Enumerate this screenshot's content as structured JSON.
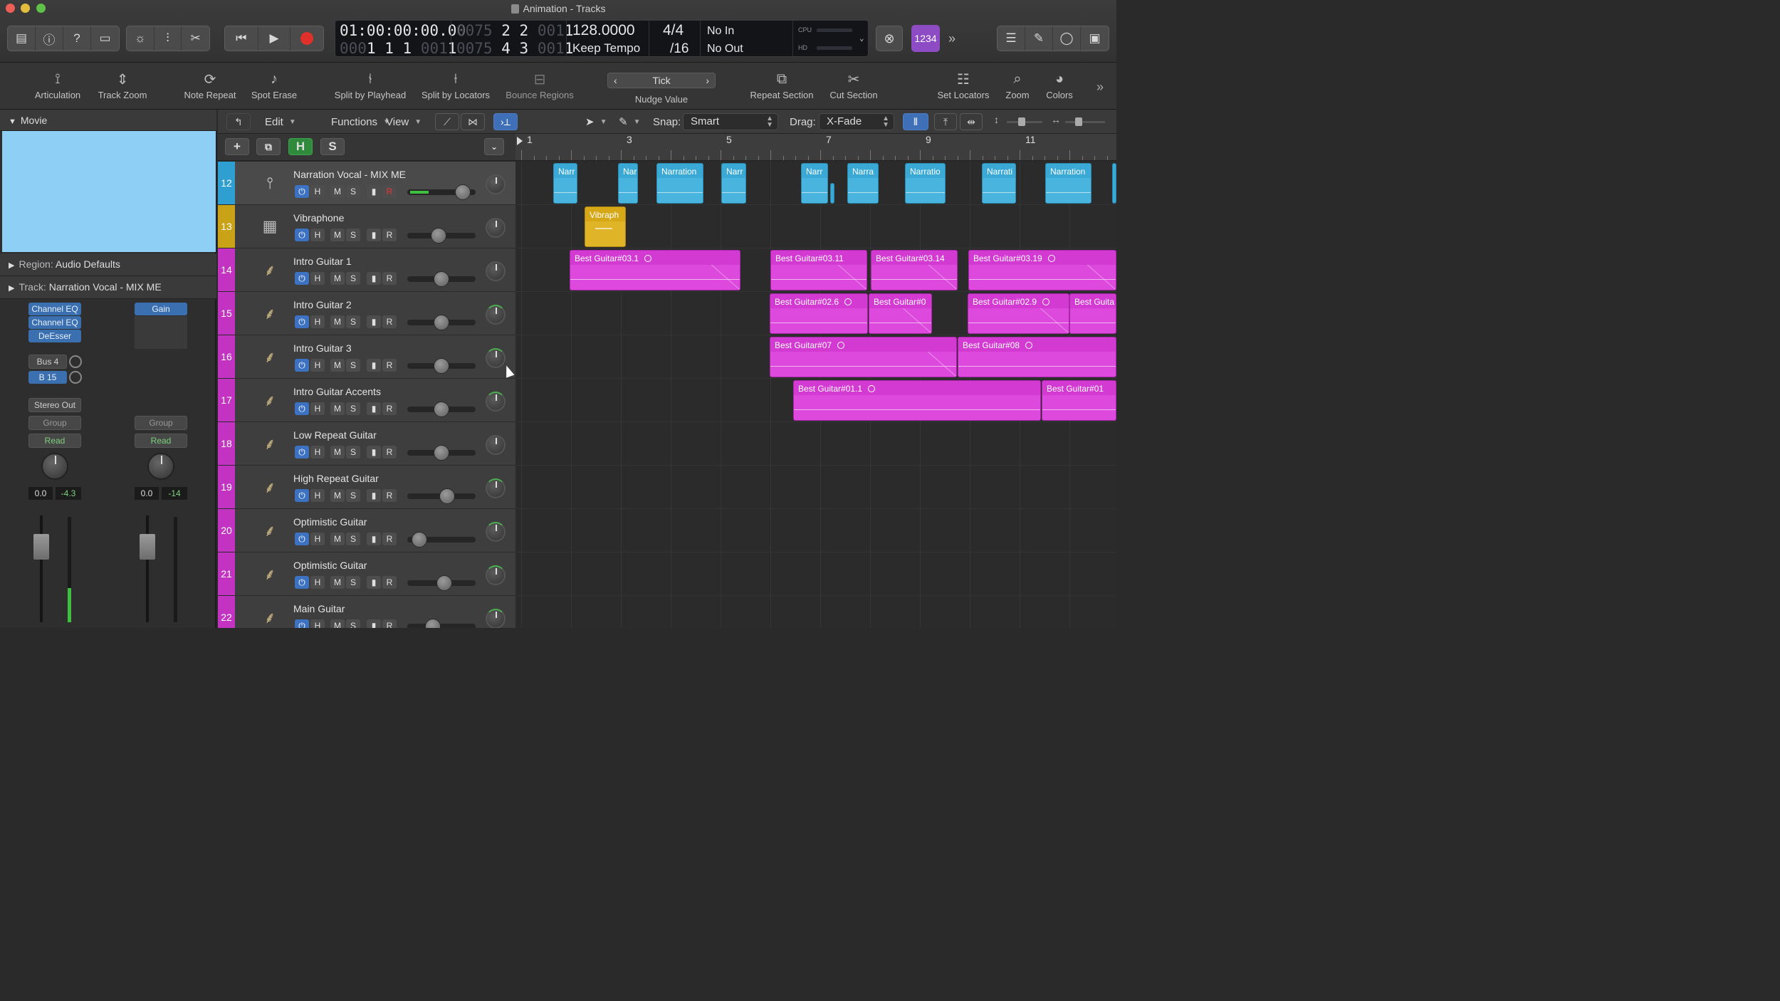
{
  "window": {
    "title": "Animation - Tracks"
  },
  "lcd": {
    "smpte": "01:00:00:00.00",
    "smpte_sub_dim": "000",
    "smpte_sub": "1  1  1",
    "smpte_sub_tail_dim": "001",
    "smpte_sub_tail": "1",
    "bars_top_dim": "0075",
    "bars_top": "2  2",
    "bars_top_tail_dim": "001",
    "bars_top_tail": "1",
    "bars_bot_dim": "0075",
    "bars_bot": "4  3",
    "bars_bot_tail_dim": "001",
    "bars_bot_tail": "1",
    "tempo": "128.0000",
    "tempo_mode": "Keep Tempo",
    "signature_top": "4/4",
    "signature_bottom": "/16",
    "in_label": "No In",
    "out_label": "No Out",
    "cpu_label": "CPU",
    "hd_label": "HD"
  },
  "badge": "1234",
  "toolbar": {
    "articulation": "Articulation",
    "track_zoom": "Track Zoom",
    "note_repeat": "Note Repeat",
    "spot_erase": "Spot Erase",
    "split_by_playhead": "Split by Playhead",
    "split_by_locators": "Split by Locators",
    "bounce_regions": "Bounce Regions",
    "nudge_value_label": "Nudge Value",
    "nudge_value": "Tick",
    "repeat_section": "Repeat Section",
    "cut_section": "Cut Section",
    "set_locators": "Set Locators",
    "zoom": "Zoom",
    "colors": "Colors"
  },
  "inspector": {
    "movie_label": "Movie",
    "region_label": "Region:",
    "region_value": "Audio Defaults",
    "track_label": "Track:",
    "track_value": "Narration Vocal - MIX ME",
    "plugins": [
      "Channel EQ",
      "Channel EQ",
      "DeEsser"
    ],
    "gain_plugin": "Gain",
    "bus_label": "Bus 4",
    "bus_value": "B 15",
    "output": "Stereo Out",
    "group_left": "Group",
    "group_right": "Group",
    "read_left": "Read",
    "read_right": "Read",
    "vol_left": "0.0",
    "peak_left": "-4.3",
    "vol_right": "0.0",
    "peak_right": "-14"
  },
  "tracks_toolbar": {
    "edit": "Edit",
    "functions": "Functions",
    "view": "View",
    "snap_label": "Snap:",
    "snap_value": "Smart",
    "drag_label": "Drag:",
    "drag_value": "X-Fade",
    "h_label": "H",
    "s_label": "S"
  },
  "ruler": {
    "bars": [
      "1",
      "3",
      "5",
      "7",
      "9",
      "11"
    ]
  },
  "tracks": [
    {
      "num": "12",
      "name": "Narration Vocal - MIX ME",
      "color": "#2e9fd0",
      "icon": "microphone-icon",
      "vol": 0.74
    },
    {
      "num": "13",
      "name": "Vibraphone",
      "color": "#c9a218",
      "icon": "speaker-icon",
      "vol": 0.39
    },
    {
      "num": "14",
      "name": "Intro Guitar 1",
      "color": "#c233c2",
      "icon": "guitar-icon",
      "vol": 0.43
    },
    {
      "num": "15",
      "name": "Intro Guitar 2",
      "color": "#c233c2",
      "icon": "guitar-icon",
      "vol": 0.43
    },
    {
      "num": "16",
      "name": "Intro Guitar 3",
      "color": "#c233c2",
      "icon": "guitar-icon",
      "vol": 0.43
    },
    {
      "num": "17",
      "name": "Intro Guitar Accents",
      "color": "#c233c2",
      "icon": "guitar-icon",
      "vol": 0.43
    },
    {
      "num": "18",
      "name": "Low Repeat Guitar",
      "color": "#c233c2",
      "icon": "guitar-icon",
      "vol": 0.43
    },
    {
      "num": "19",
      "name": "High Repeat Guitar",
      "color": "#c233c2",
      "icon": "guitar-icon",
      "vol": 0.51
    },
    {
      "num": "20",
      "name": "Optimistic Guitar",
      "color": "#c233c2",
      "icon": "guitar-icon",
      "vol": 0.1
    },
    {
      "num": "21",
      "name": "Optimistic Guitar",
      "color": "#c233c2",
      "icon": "guitar-icon",
      "vol": 0.47
    },
    {
      "num": "22",
      "name": "Main Guitar",
      "color": "#c233c2",
      "icon": "guitar-icon",
      "vol": 0.3
    }
  ],
  "track_buttons": {
    "h": "H",
    "m": "M",
    "s": "S",
    "r": "R"
  },
  "regions": {
    "narration": [
      "Narr",
      "Nar",
      "Narration",
      "Narr",
      "Narr",
      "Narra",
      "Narratio",
      "Narrati",
      "Narration"
    ],
    "vibraphone": "Vibraph",
    "lane14": [
      "Best Guitar#03.1",
      "Best Guitar#03.11",
      "Best Guitar#03.14",
      "Best Guitar#03.19"
    ],
    "lane15": [
      "Best Guitar#02.6",
      "Best Guitar#0",
      "Best Guitar#02.9",
      "Best Guita"
    ],
    "lane16": [
      "Best Guitar#07",
      "Best Guitar#08"
    ],
    "lane17": [
      "Best Guitar#01.1",
      "Best Guitar#01"
    ]
  },
  "colors": {
    "accent_blue": "#3d72c2",
    "track_blue": "#3aa9d6",
    "track_magenta": "#d23ad2",
    "track_yellow": "#d6a717",
    "badge_purple": "#8e4cc4",
    "record_red": "#e0302a"
  }
}
